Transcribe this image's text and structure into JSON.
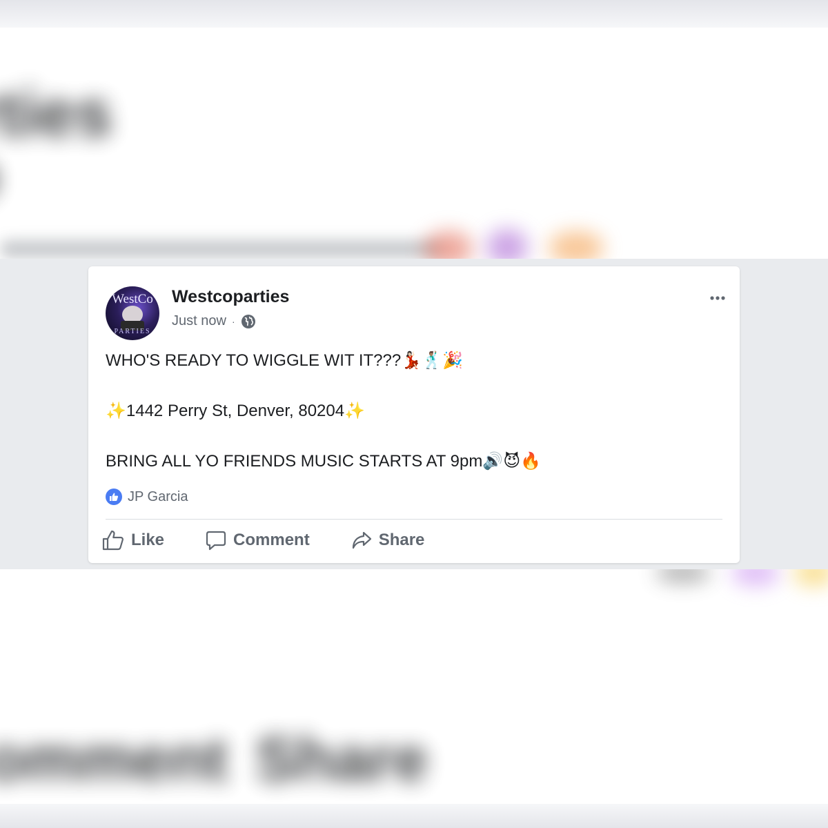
{
  "post": {
    "page_name": "Westcoparties",
    "timestamp": "Just now",
    "separator": "·",
    "avatar": {
      "top_text": "WestCo",
      "bottom_text": "PARTIES"
    },
    "lines": [
      "WHO'S READY TO WIGGLE WIT IT???💃🏻🕺🏽🎉",
      "✨1442 Perry St, Denver, 80204✨",
      "BRING ALL YO FRIENDS MUSIC STARTS AT 9pm🔊😈🔥"
    ],
    "reactions": {
      "icon": "like-icon",
      "names": "JP Garcia"
    },
    "actions": {
      "like": "Like",
      "comment": "Comment",
      "share": "Share"
    }
  },
  "background": {
    "blur_top_1": "rties",
    "blur_top_2": "o",
    "blur_bottom_1": "omment",
    "blur_bottom_2": "Share"
  },
  "colors": {
    "brand_blue": "#4a7cf3",
    "text_primary": "#1c1e21",
    "text_secondary": "#606770",
    "band": "#e9ebee"
  }
}
